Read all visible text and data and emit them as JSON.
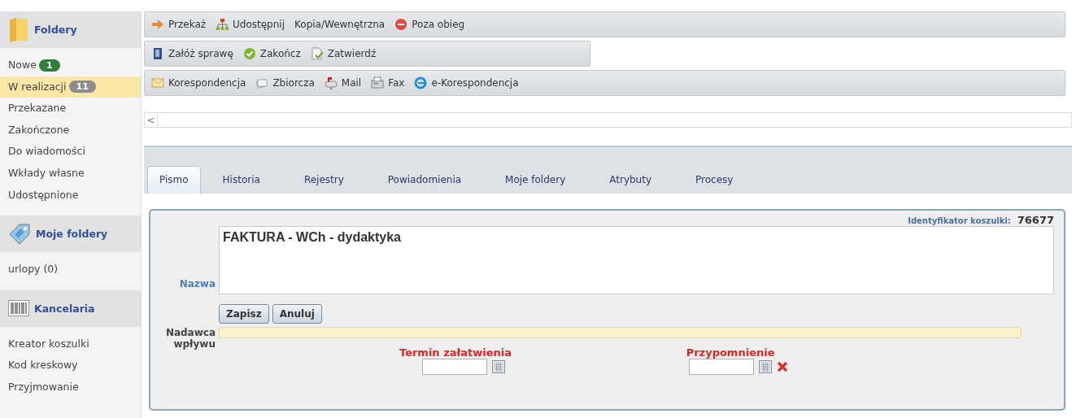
{
  "sidebar": {
    "sections": [
      {
        "title": "Foldery",
        "items": [
          {
            "label": "Nowe",
            "badge": {
              "text": "1",
              "color": "#2f7d3b"
            },
            "selected": false
          },
          {
            "label": "W realizacji",
            "badge": {
              "text": "11",
              "color": "#8c8c8c"
            },
            "selected": true
          },
          {
            "label": "Przekazane",
            "selected": false
          },
          {
            "label": "Zakończone",
            "selected": false
          },
          {
            "label": "Do wiadomości",
            "selected": false
          },
          {
            "label": "Wkłady własne",
            "selected": false
          },
          {
            "label": "Udostępnione",
            "selected": false
          }
        ]
      },
      {
        "title": "Moje foldery",
        "items": [
          {
            "label": "urlopy (0)",
            "selected": false
          }
        ]
      },
      {
        "title": "Kancelaria",
        "items": [
          {
            "label": "Kreator koszulki",
            "selected": false
          },
          {
            "label": "Kod kreskowy",
            "selected": false
          },
          {
            "label": "Przyjmowanie",
            "selected": false
          }
        ]
      }
    ]
  },
  "toolbars": [
    {
      "buttons": [
        "Przekaż",
        "Udostępnij",
        "Kopia/Wewnętrzna",
        "Poza obieg"
      ]
    },
    {
      "buttons": [
        "Załóż sprawę",
        "Zakończ",
        "Zatwierdź"
      ]
    },
    {
      "buttons": [
        "Korespondencja",
        "Zbiorcza",
        "Mail",
        "Fax",
        "e-Korespondencja"
      ]
    }
  ],
  "scroller": {
    "arrow": "<"
  },
  "tabs": [
    {
      "label": "Pismo",
      "selected": true
    },
    {
      "label": "Historia",
      "selected": false
    },
    {
      "label": "Rejestry",
      "selected": false
    },
    {
      "label": "Powiadomienia",
      "selected": false
    },
    {
      "label": "Moje foldery",
      "selected": false
    },
    {
      "label": "Atrybuty",
      "selected": false
    },
    {
      "label": "Procesy",
      "selected": false
    }
  ],
  "form": {
    "id_label": "Identyfikator koszulki:",
    "id_value": "76677",
    "name_label": "Nazwa",
    "name_value": "FAKTURA - WCh - dydaktyka",
    "buttons": [
      "Zapisz",
      "Anuluj"
    ],
    "sender_label": "Nadawca wpływu",
    "due_label": "Termin załatwienia",
    "reminder_label": "Przypomnienie"
  }
}
